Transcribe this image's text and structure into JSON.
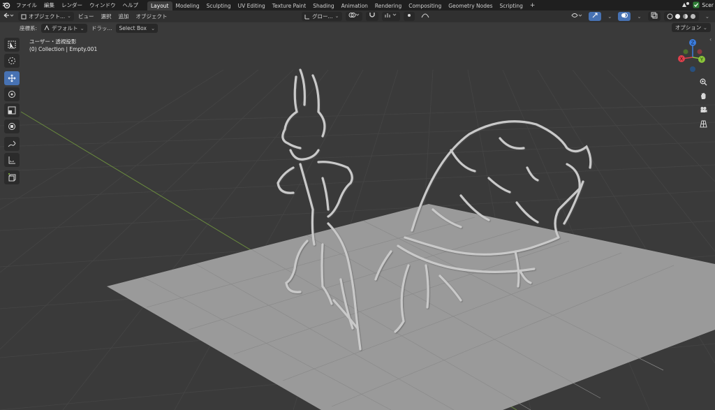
{
  "app": {
    "logo": "blender-logo-icon",
    "scene_label": "Scer"
  },
  "menu": [
    "ファイル",
    "編集",
    "レンダー",
    "ウィンドウ",
    "ヘルプ"
  ],
  "workspaces": {
    "active": "Layout",
    "tabs": [
      "Layout",
      "Modeling",
      "Sculpting",
      "UV Editing",
      "Texture Paint",
      "Shading",
      "Animation",
      "Rendering",
      "Compositing",
      "Geometry Nodes",
      "Scripting"
    ],
    "add_label": "+"
  },
  "header": {
    "mode": "オブジェクト...",
    "view": "ビュー",
    "select": "選択",
    "add": "追加",
    "object": "オブジェクト",
    "transform_orientation": "グロー..."
  },
  "tool_settings": {
    "orientation_label": "座標系:",
    "orientation_value": "デフォルト",
    "drag_label": "ドラッ...",
    "select_mode": "Select Box",
    "options": "オプション"
  },
  "viewport": {
    "view_name": "ユーザー・透視投影",
    "collection_info": "(0) Collection | Empty.001",
    "background_color": "#3a3a3a",
    "grid_color": "#474747",
    "plane_color": "#9a9a9a"
  },
  "gizmo_axes": {
    "x": "X",
    "y": "Y",
    "z": "Z",
    "x_color": "#e0404c",
    "y_color": "#8bc63a",
    "z_color": "#3c7ee0"
  },
  "toolbar_icons": [
    "cursor-select-icon",
    "cursor-3d-icon",
    "move-icon",
    "rotate-icon",
    "scale-icon",
    "transform-icon",
    "annotate-icon",
    "measure-icon",
    "add-cube-icon"
  ],
  "nav_icons": [
    "zoom-icon",
    "pan-hand-icon",
    "camera-icon",
    "grid-view-icon"
  ]
}
